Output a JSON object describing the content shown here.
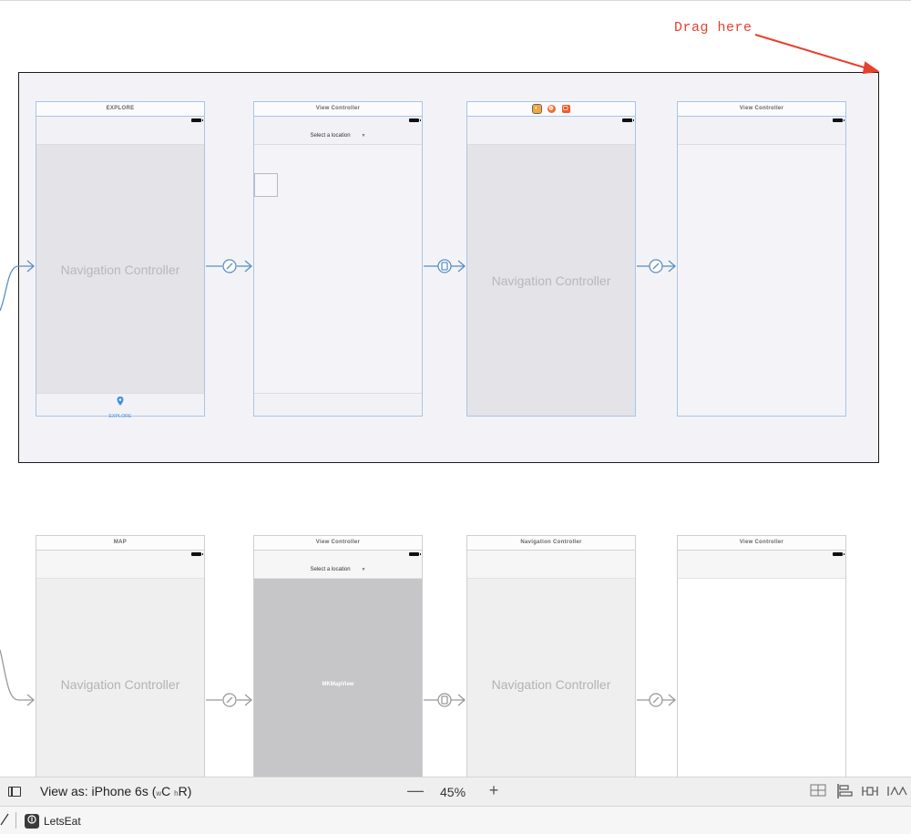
{
  "annotation": {
    "text": "Drag here",
    "color": "#e8402c"
  },
  "row1": {
    "scene1": {
      "title": "EXPLORE",
      "body": "Navigation Controller",
      "tab_label": "EXPLORE"
    },
    "scene2": {
      "title": "View Controller",
      "nav_title": "Select a location"
    },
    "scene3": {
      "body": "Navigation Controller"
    },
    "scene4": {
      "title": "View Controller"
    }
  },
  "row2": {
    "scene1": {
      "title": "MAP",
      "body": "Navigation Controller"
    },
    "scene2": {
      "title": "View Controller",
      "nav_title": "Select a location",
      "map_label": "MKMapView"
    },
    "scene3": {
      "title": "Navigation Controller",
      "body": "Navigation Controller"
    },
    "scene4": {
      "title": "View Controller"
    }
  },
  "status_bar": {
    "view_as": "View as: iPhone 6s (",
    "size_w": "w",
    "size_c": "C",
    "size_h": "h",
    "size_r": "R",
    "size_close": ")",
    "zoom_minus": "—",
    "zoom_level": "45%",
    "zoom_plus": "+"
  },
  "scheme_bar": {
    "scheme_name": "LetsEat"
  },
  "colors": {
    "accent": "#3e8ee0",
    "segue": "#5b8fc6",
    "segue_dim": "#9a9a9a"
  },
  "icons": {
    "tab": "map-pin-icon",
    "segue_relationship": "link-icon",
    "segue_show": "device-icon",
    "title_icons": [
      "view-controller-icon",
      "first-responder-icon",
      "exit-icon"
    ],
    "tools": [
      "update-frames-icon",
      "align-icon",
      "pin-icon",
      "resolve-issues-icon"
    ]
  }
}
